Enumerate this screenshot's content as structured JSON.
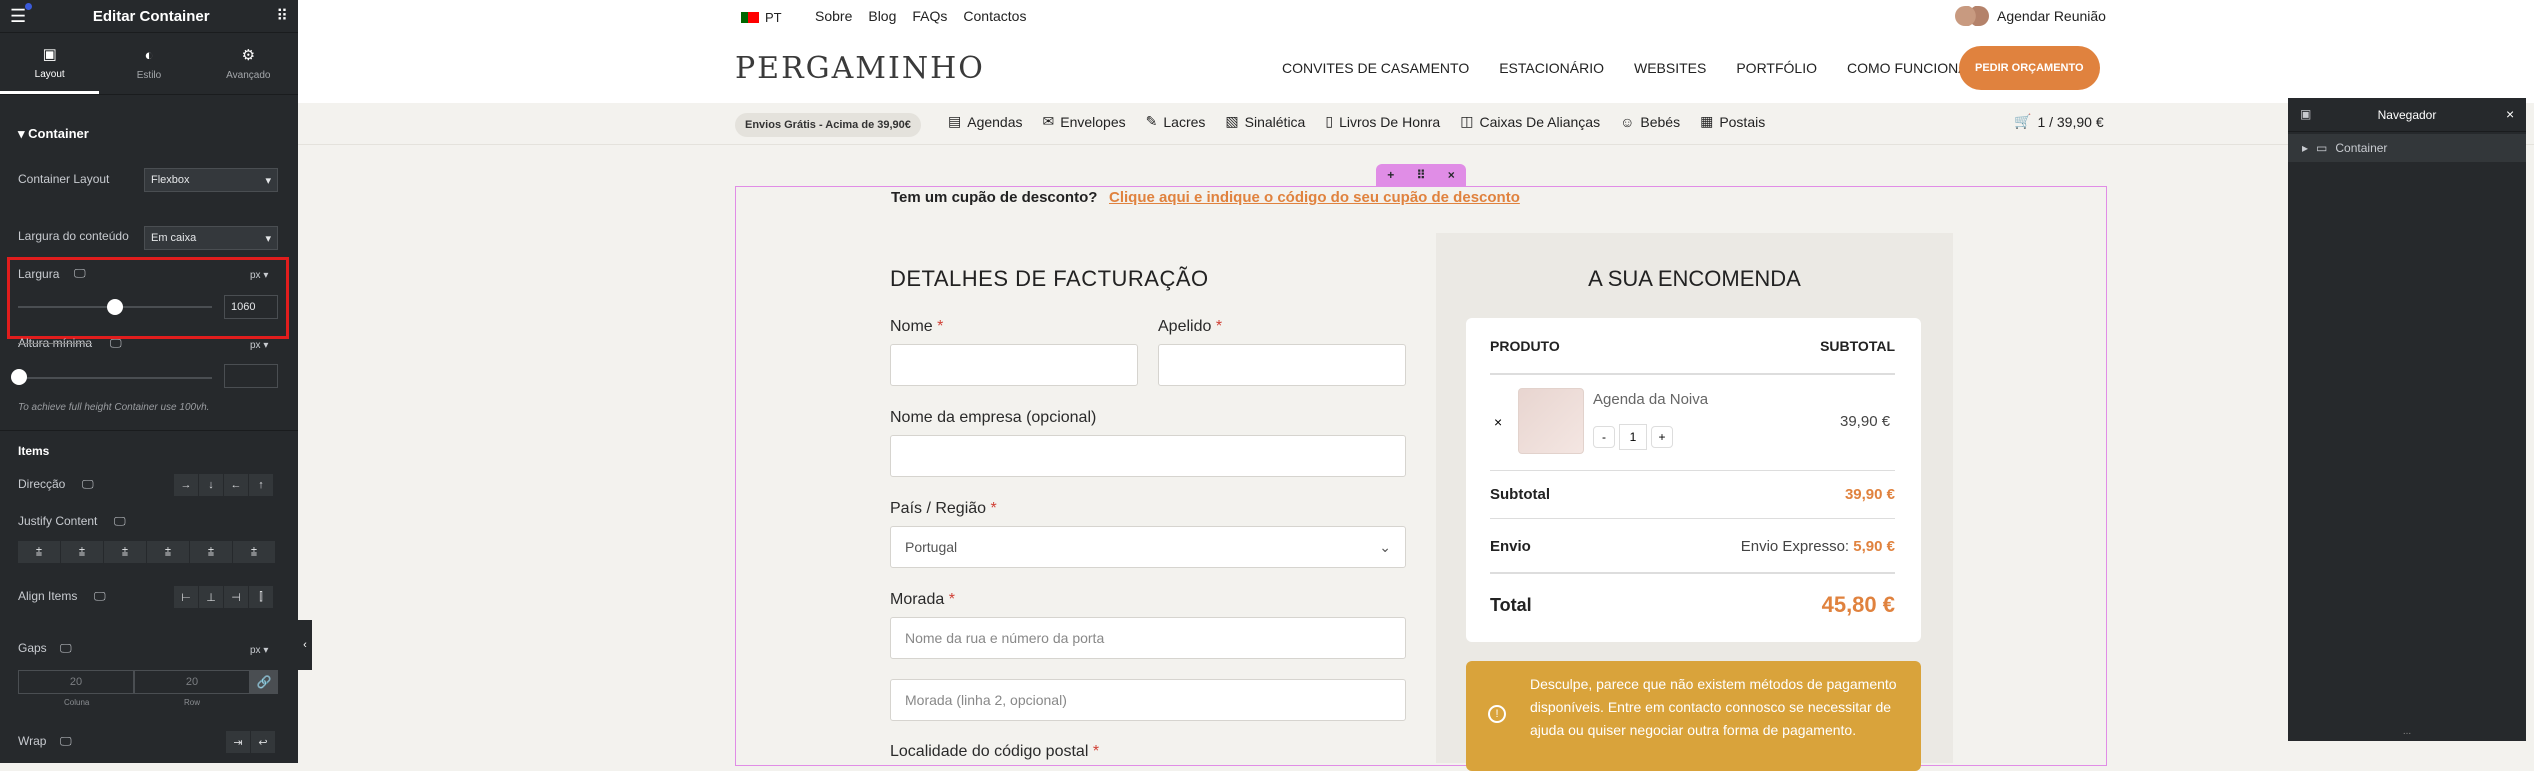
{
  "panel": {
    "title": "Editar Container",
    "tabs": [
      {
        "label": "Layout"
      },
      {
        "label": "Estilo"
      },
      {
        "label": "Avançado"
      }
    ],
    "section": "Container",
    "container_layout": {
      "label": "Container Layout",
      "value": "Flexbox"
    },
    "content_width": {
      "label": "Largura do conteúdo",
      "value": "Em caixa"
    },
    "width": {
      "label": "Largura",
      "unit": "px",
      "value": "1060",
      "slider_fraction": 0.5
    },
    "min_height": {
      "label": "Altura mínima",
      "unit": "px",
      "value": "",
      "hint": "To achieve full height Container use 100vh."
    },
    "items_title": "Items",
    "direction": {
      "label": "Direcção",
      "buttons": [
        "→",
        "↓",
        "←",
        "↑"
      ]
    },
    "justify": {
      "label": "Justify Content"
    },
    "align": {
      "label": "Align Items"
    },
    "gaps": {
      "label": "Gaps",
      "unit": "px",
      "column": "20",
      "row": "20",
      "column_label": "Coluna",
      "row_label": "Row"
    },
    "wrap": {
      "label": "Wrap"
    }
  },
  "topbar": {
    "lang": "PT",
    "links": [
      "Sobre",
      "Blog",
      "FAQs",
      "Contactos"
    ],
    "schedule": "Agendar Reunião"
  },
  "nav": {
    "logo": "PERGAMINHO",
    "items": [
      "CONVITES DE CASAMENTO",
      "ESTACIONÁRIO",
      "WEBSITES",
      "PORTFÓLIO",
      "COMO FUNCIONA?"
    ],
    "cta": "PEDIR ORÇAMENTO"
  },
  "subnav": {
    "pill": "Envios Grátis - Acima de 39,90€",
    "items": [
      "Agendas",
      "Envelopes",
      "Lacres",
      "Sinalética",
      "Livros De Honra",
      "Caixas De Alianças",
      "Bebés",
      "Postais"
    ],
    "cart": "1 / 39,90 €"
  },
  "coupon": {
    "question": "Tem um cupão de desconto?",
    "link": "Clique aqui e indique o código do seu cupão de desconto"
  },
  "billing": {
    "title": "DETALHES DE FACTURAÇÃO",
    "first_name": "Nome",
    "last_name": "Apelido",
    "company": "Nome da empresa (opcional)",
    "country": "País / Região",
    "country_value": "Portugal",
    "address": "Morada",
    "address_ph": "Nome da rua e número da porta",
    "address2_ph": "Morada (linha 2, opcional)",
    "postcode": "Localidade do código postal",
    "required_mark": "*"
  },
  "order": {
    "title": "A SUA ENCOMENDA",
    "col_product": "PRODUTO",
    "col_subtotal": "SUBTOTAL",
    "product": "Agenda da Noiva",
    "qty": "1",
    "minus": "-",
    "plus": "+",
    "remove": "×",
    "price": "39,90 €",
    "subtotal_label": "Subtotal",
    "subtotal": "39,90 €",
    "shipping_label": "Envio",
    "shipping_method": "Envio Expresso:",
    "shipping_price": "5,90 €",
    "total_label": "Total",
    "total": "45,80 €",
    "notice": "Desculpe, parece que não existem métodos de pagamento disponíveis. Entre em contacto connosco se necessitar de ajuda ou quiser negociar outra forma de pagamento."
  },
  "navigator": {
    "title": "Navegador",
    "item": "Container",
    "footer": "..."
  },
  "colors": {
    "accent": "#e0823e",
    "elementor_pink": "#e08de6",
    "panel_bg": "#26292c",
    "highlight": "#e11d1d"
  }
}
